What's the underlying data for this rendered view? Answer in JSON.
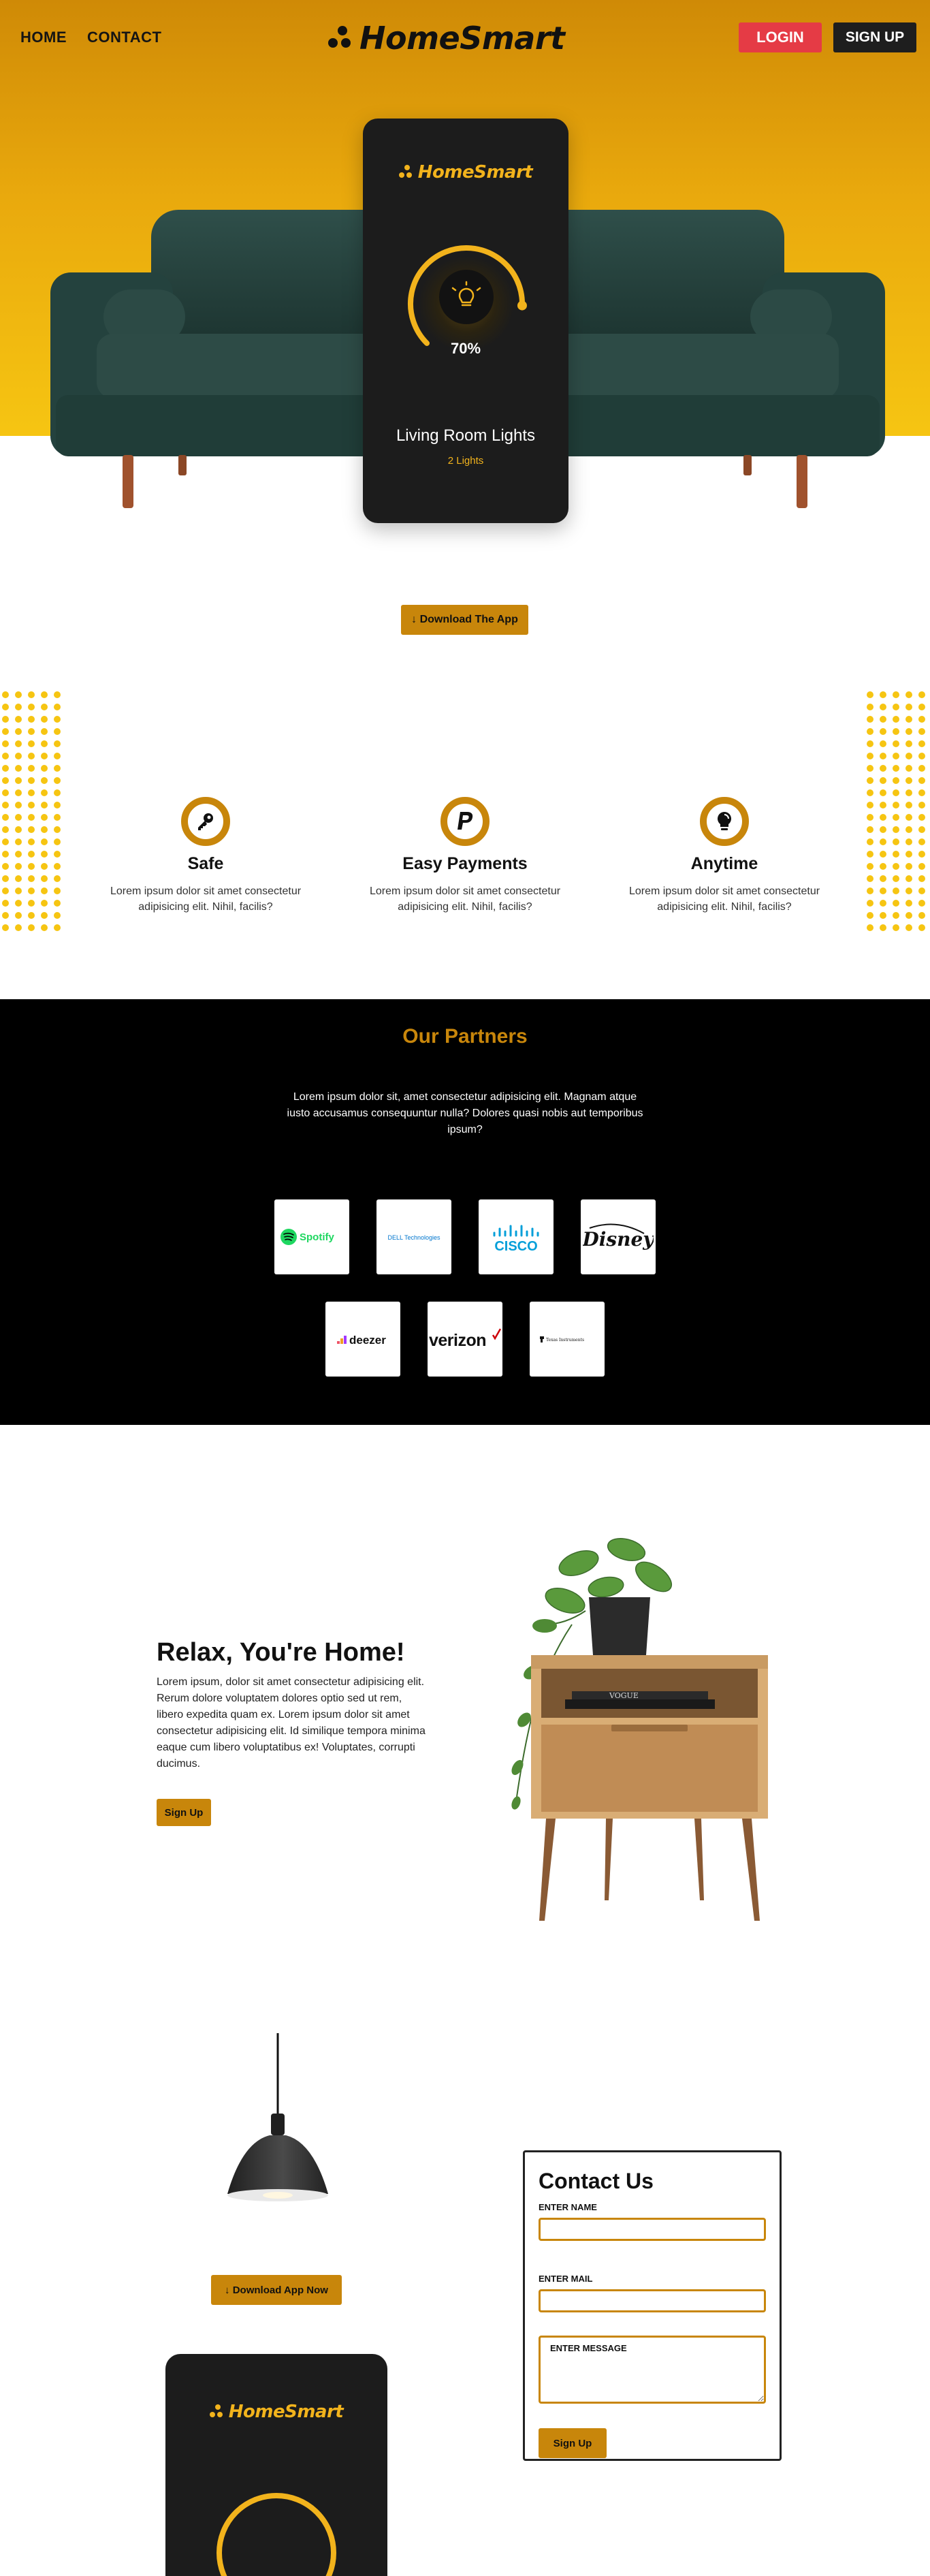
{
  "nav": {
    "home_label": "HOME",
    "contact_label": "CONTACT",
    "brand": "HomeSmart",
    "login_label": "LOGIN",
    "signup_label": "SIGN UP"
  },
  "hero": {
    "phone_brand": "HomeSmart",
    "dial_percent": "70%",
    "dial_level": 0.7,
    "phone_title": "Living Room Lights",
    "phone_subtitle": "2 Lights",
    "download_label": "↓ Download The App"
  },
  "features": [
    {
      "title": "Safe",
      "text": "Lorem ipsum dolor sit amet consectetur adipisicing elit. Nihil, facilis?",
      "icon": "key-icon"
    },
    {
      "title": "Easy Payments",
      "text": "Lorem ipsum dolor sit amet consectetur adipisicing elit. Nihil, facilis?",
      "icon": "paypal-icon"
    },
    {
      "title": "Anytime",
      "text": "Lorem ipsum dolor sit amet consectetur adipisicing elit. Nihil, facilis?",
      "icon": "lightbulb-icon"
    }
  ],
  "partners": {
    "title": "Our Partners",
    "text": "Lorem ipsum dolor sit, amet consectetur adipisicing elit. Magnam atque iusto accusamus consequuntur nulla? Dolores quasi nobis aut temporibus ipsum?",
    "logos": [
      "Spotify",
      "DELL Technologies",
      "CISCO",
      "Disney",
      "deezer",
      "verizon",
      "Texas Instruments"
    ]
  },
  "relax": {
    "title": "Relax, You're Home!",
    "text": "Lorem ipsum, dolor sit amet consectetur adipisicing elit. Rerum dolore voluptatem dolores optio sed ut rem, libero expedita quam ex. Lorem ipsum dolor sit amet consectetur adipisicing elit. Id similique tempora minima eaque cum libero voluptatibus ex! Voluptates, corrupti ducimus.",
    "button_label": "Sign Up",
    "book_label": "VOGUE"
  },
  "contact": {
    "download_label": "↓ Download App Now",
    "phone_brand": "HomeSmart",
    "title": "Contact Us",
    "name_label": "ENTER NAME",
    "mail_label": "ENTER MAIL",
    "message_placeholder": "ENTER MESSAGE",
    "button_label": "Sign Up"
  },
  "colors": {
    "accent": "#c8860b",
    "hero_top": "#cf8a06",
    "hero_bottom": "#f6c512",
    "login": "#e53b45",
    "dark": "#1c1c1c",
    "phone_accent": "#f2b31c"
  }
}
